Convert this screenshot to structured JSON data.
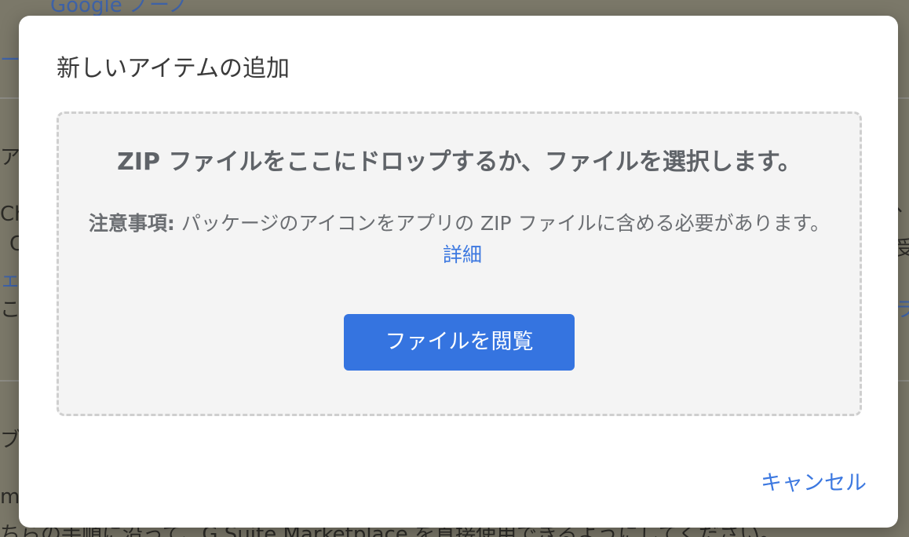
{
  "background": {
    "fragments": [
      "Google ノーノ",
      "ーラ",
      "アの",
      "Chr",
      "C",
      "ェ ブ",
      "こし",
      "ブ",
      "me",
      "ちらの手順に沿って、G Suite Marketplace を直接使用できるようにしてください。",
      "、",
      "受",
      "ラ"
    ]
  },
  "dialog": {
    "title": "新しいアイテムの追加",
    "dropzone": {
      "heading": "ZIP ファイルをここにドロップするか、ファイルを選択します。",
      "note_label": "注意事項:",
      "note_text": " パッケージのアイコンをアプリの ZIP ファイルに含める必要があります。",
      "details_link": "詳細",
      "browse_button": "ファイルを閲覧"
    },
    "cancel_button": "キャンセル"
  },
  "colors": {
    "accent": "#3574e0",
    "link": "#3c78e0",
    "overlay": "#7b7869",
    "dropzone_bg": "#f4f4f4"
  }
}
